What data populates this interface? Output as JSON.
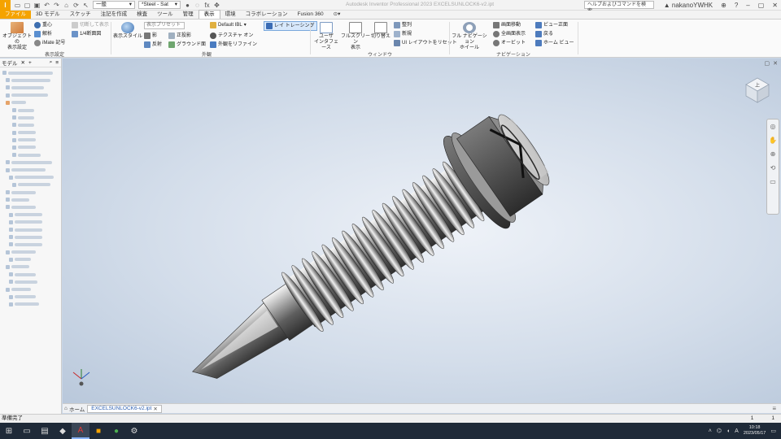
{
  "titlebar": {
    "logo": "I",
    "appearance_dd": "一般",
    "material_dd": "*Steel - Sat",
    "title": "Autodesk Inventor Professional 2023   EXCELSUNLOCK6-v2.ipt",
    "search_placeholder": "ヘルプおよびコマンドを検索...",
    "user": "▲ nakanoYWHK"
  },
  "tabs": [
    "ファイル",
    "3D モデル",
    "スケッチ",
    "注記を作成",
    "検査",
    "ツール",
    "管理",
    "表示",
    "環境",
    "コラボレーション",
    "Fusion 360"
  ],
  "active_tab": "表示",
  "ribbon": {
    "obj_display": "オブジェクトの\n表示設定",
    "center_of_gravity": "重心",
    "analysis": "解析",
    "imate": "iMate 記号",
    "half_section": "切断して表示",
    "quarter_section": "1/4断面図",
    "group_display": "表示設定",
    "display_style": "表示スタイル",
    "display_preset": "表示プリセット",
    "shadow": "影",
    "reflection": "反射",
    "orthographic": "正投影",
    "ground_plane": "グラウンド面",
    "ibl": "Default IBL",
    "texture_on": "テクスチャ オン",
    "refine_appearance": "外観をリファイン",
    "ray_tracing": "レイ トレーシング",
    "group_appearance": "外観",
    "user_interface": "ユーザ\nインタフェース",
    "fullscreen": "フルスクリーン\n表示",
    "switch": "切り替え",
    "arrange": "整列",
    "new_window": "新規",
    "reset_ui": "UI レイアウトをリセット",
    "group_window": "ウィンドウ",
    "full_nav_wheel": "フル ナビゲーション\nホイール",
    "pan": "画面移動",
    "zoom_all": "全画面表示",
    "orbit": "オービット",
    "view_face": "ビュー正面",
    "previous": "戻る",
    "home_view": "ホーム ビュー",
    "group_navigation": "ナビゲーション"
  },
  "browser": {
    "tab": "モデル",
    "plus": "+",
    "item_count": 32
  },
  "viewport": {
    "viewcube_label": "上"
  },
  "doc_tabs": {
    "home": "ホーム",
    "active": "EXCELSUNLOCK6-v2.ipt"
  },
  "status": {
    "text": "準備完了",
    "right1": "1",
    "right2": "1"
  },
  "taskbar": {
    "time": "10:18",
    "date": "2023/05/17",
    "ime": "A"
  },
  "colors": {
    "accent": "#f5a300",
    "taskbar": "#1f2a38",
    "viewport": "#d3ddea"
  }
}
